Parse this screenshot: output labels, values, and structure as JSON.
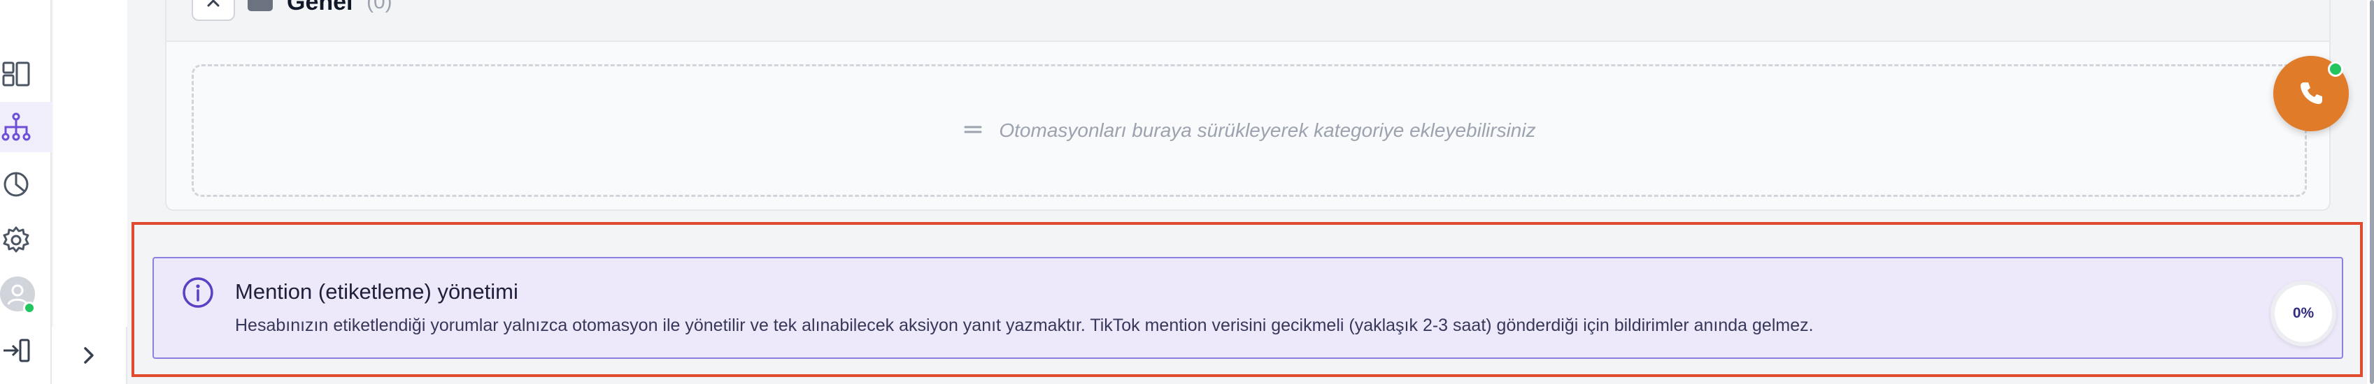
{
  "category": {
    "title": "Genel",
    "count": "(0)",
    "dropzone_text": "Otomasyonları buraya sürükleyerek kategoriye ekleyebilirsiniz"
  },
  "info_banner": {
    "title": "Mention (etiketleme) yönetimi",
    "description": "Hesabınızın etiketlendiği yorumlar yalnızca otomasyon ile yönetilir ve tek alınabilecek aksiyon yanıt yazmaktır. TikTok mention verisini gecikmeli (yaklaşık 2-3 saat) gönderdiği için bildirimler anında gelmez."
  },
  "progress": {
    "label": "0%",
    "value": 0
  },
  "colors": {
    "accent": "#6d4fd6",
    "highlight_frame": "#e04a2f",
    "banner_bg": "#ede9fb",
    "call_button": "#e07b2a",
    "online": "#22c55e"
  },
  "sidebar": {
    "icons": [
      "dashboard-icon",
      "automation-tree-icon",
      "analytics-pie-icon",
      "settings-gear-icon",
      "user-avatar",
      "logout-icon"
    ],
    "active": "automation-tree-icon",
    "expand_icon": "chevron-right-icon"
  }
}
